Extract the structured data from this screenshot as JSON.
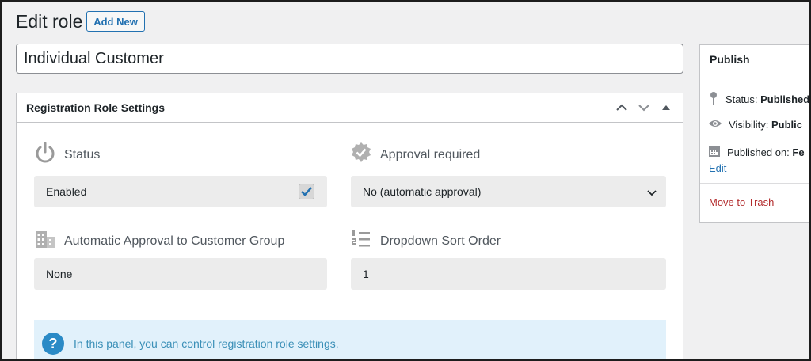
{
  "header": {
    "title": "Edit role",
    "add_new_label": "Add New"
  },
  "role": {
    "name": "Individual Customer"
  },
  "panel": {
    "title": "Registration Role Settings",
    "status": {
      "label": "Status",
      "value": "Enabled",
      "checked": true
    },
    "approval": {
      "label": "Approval required",
      "value": "No (automatic approval)"
    },
    "auto_group": {
      "label": "Automatic Approval to Customer Group",
      "value": "None"
    },
    "sort_order": {
      "label": "Dropdown Sort Order",
      "value": "1"
    },
    "info_text": "In this panel, you can control registration role settings."
  },
  "publish": {
    "title": "Publish",
    "status_label": "Status:",
    "status_value": "Published",
    "visibility_label": "Visibility:",
    "visibility_value": "Public",
    "published_on_label": "Published on:",
    "published_on_value": "Fe",
    "edit_link": "Edit",
    "trash_link": "Move to Trash"
  },
  "colors": {
    "accent": "#2271b1",
    "danger": "#b32d2e",
    "info_bg": "#e1f1fb",
    "info_icon": "#2a8ac6"
  }
}
